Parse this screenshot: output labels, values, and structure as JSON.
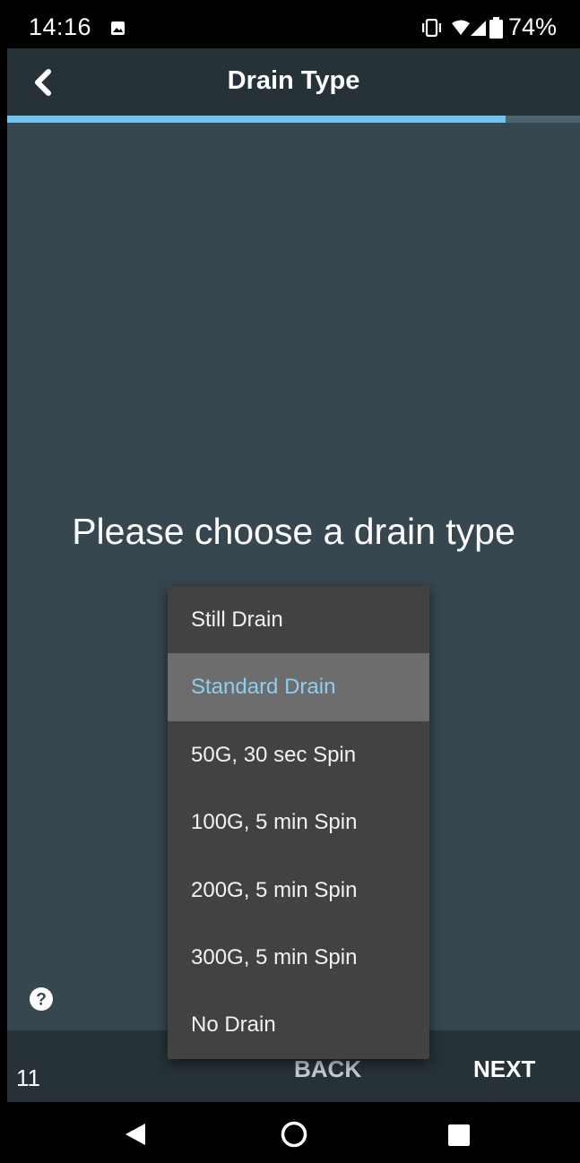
{
  "status_bar": {
    "time": "14:16",
    "battery": "74%",
    "icons": [
      "gallery-icon",
      "vibrate-icon",
      "wifi-icon",
      "signal-icon",
      "battery-icon"
    ]
  },
  "app_bar": {
    "title": "Drain Type",
    "back_icon": "chevron-left-icon"
  },
  "progress": {
    "fraction": 0.87,
    "color": "#6ec4ec"
  },
  "main": {
    "prompt": "Please choose a drain type",
    "help_icon": "question-circle-icon"
  },
  "dropdown": {
    "selected": "Standard Drain",
    "options": [
      "Still Drain",
      "Standard Drain",
      "50G, 30 sec Spin",
      "100G, 5 min Spin",
      "200G, 5 min Spin",
      "300G, 5 min Spin",
      "No Drain"
    ]
  },
  "footer": {
    "step": "11",
    "back_label": "BACK",
    "next_label": "NEXT"
  },
  "nav_bar": {
    "icons": [
      "nav-back-icon",
      "nav-home-icon",
      "nav-recents-icon"
    ]
  },
  "colors": {
    "app_bar": "#263238",
    "content_bg": "#37474f",
    "dropdown_bg": "#424242",
    "selected_bg": "#6d6d6d",
    "accent": "#8ccff0"
  }
}
